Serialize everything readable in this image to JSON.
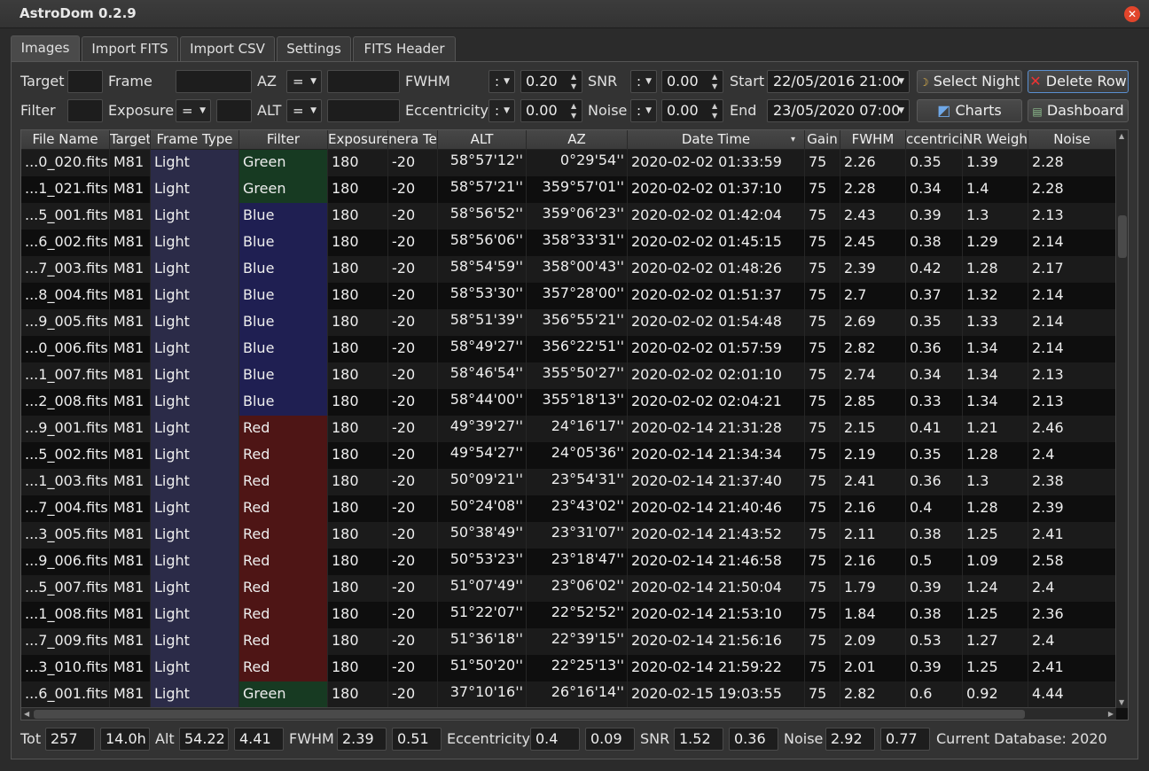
{
  "window": {
    "title": "AstroDom 0.2.9",
    "close_icon": "close-icon"
  },
  "tabs": [
    "Images",
    "Import FITS",
    "Import CSV",
    "Settings",
    "FITS Header"
  ],
  "filters": {
    "target_label": "Target",
    "target_value": "",
    "frame_label": "Frame",
    "frame_value": "",
    "az_label": "AZ",
    "az_op": "=",
    "az_value": "",
    "fwhm_label": "FWHM",
    "fwhm_op": ":",
    "fwhm_value": "0.20",
    "snr_label": "SNR",
    "snr_op": ":",
    "snr_value": "0.00",
    "start_label": "Start",
    "start_value": "22/05/2016 21:00",
    "filter_label": "Filter",
    "filter_value": "",
    "exposure_label": "Exposure",
    "exposure_op": "=",
    "exposure_value": "",
    "alt_label": "ALT",
    "alt_op": "=",
    "alt_value": "",
    "ecc_label": "Eccentricity",
    "ecc_op": ":",
    "ecc_value": "0.00",
    "noise_label": "Noise",
    "noise_op": ":",
    "noise_value": "0.00",
    "end_label": "End",
    "end_value": "23/05/2020 07:00"
  },
  "buttons": {
    "select_night": "Select Night",
    "delete_row": "Delete Row",
    "charts": "Charts",
    "dashboard": "Dashboard"
  },
  "table": {
    "columns": [
      "File Name",
      "Target",
      "Frame Type",
      "Filter",
      "Exposure",
      "nera Te",
      "ALT",
      "AZ",
      "Date Time",
      "Gain",
      "FWHM",
      "ccentrici",
      "NR Weigh",
      "Noise"
    ],
    "sort_indicator": "▾",
    "rows": [
      [
        "...0_020.fits",
        "M81",
        "Light",
        "Green",
        "180",
        "-20",
        "58°57'12''",
        "0°29'54''",
        "2020-02-02  01:33:59",
        "75",
        "2.26",
        "0.35",
        "1.39",
        "2.28"
      ],
      [
        "...1_021.fits",
        "M81",
        "Light",
        "Green",
        "180",
        "-20",
        "58°57'21''",
        "359°57'01''",
        "2020-02-02  01:37:10",
        "75",
        "2.28",
        "0.34",
        "1.4",
        "2.28"
      ],
      [
        "...5_001.fits",
        "M81",
        "Light",
        "Blue",
        "180",
        "-20",
        "58°56'52''",
        "359°06'23''",
        "2020-02-02  01:42:04",
        "75",
        "2.43",
        "0.39",
        "1.3",
        "2.13"
      ],
      [
        "...6_002.fits",
        "M81",
        "Light",
        "Blue",
        "180",
        "-20",
        "58°56'06''",
        "358°33'31''",
        "2020-02-02  01:45:15",
        "75",
        "2.45",
        "0.38",
        "1.29",
        "2.14"
      ],
      [
        "...7_003.fits",
        "M81",
        "Light",
        "Blue",
        "180",
        "-20",
        "58°54'59''",
        "358°00'43''",
        "2020-02-02  01:48:26",
        "75",
        "2.39",
        "0.42",
        "1.28",
        "2.17"
      ],
      [
        "...8_004.fits",
        "M81",
        "Light",
        "Blue",
        "180",
        "-20",
        "58°53'30''",
        "357°28'00''",
        "2020-02-02  01:51:37",
        "75",
        "2.7",
        "0.37",
        "1.32",
        "2.14"
      ],
      [
        "...9_005.fits",
        "M81",
        "Light",
        "Blue",
        "180",
        "-20",
        "58°51'39''",
        "356°55'21''",
        "2020-02-02  01:54:48",
        "75",
        "2.69",
        "0.35",
        "1.33",
        "2.14"
      ],
      [
        "...0_006.fits",
        "M81",
        "Light",
        "Blue",
        "180",
        "-20",
        "58°49'27''",
        "356°22'51''",
        "2020-02-02  01:57:59",
        "75",
        "2.82",
        "0.36",
        "1.34",
        "2.14"
      ],
      [
        "...1_007.fits",
        "M81",
        "Light",
        "Blue",
        "180",
        "-20",
        "58°46'54''",
        "355°50'27''",
        "2020-02-02  02:01:10",
        "75",
        "2.74",
        "0.34",
        "1.34",
        "2.13"
      ],
      [
        "...2_008.fits",
        "M81",
        "Light",
        "Blue",
        "180",
        "-20",
        "58°44'00''",
        "355°18'13''",
        "2020-02-02  02:04:21",
        "75",
        "2.85",
        "0.33",
        "1.34",
        "2.13"
      ],
      [
        "...9_001.fits",
        "M81",
        "Light",
        "Red",
        "180",
        "-20",
        "49°39'27''",
        "24°16'17''",
        "2020-02-14  21:31:28",
        "75",
        "2.15",
        "0.41",
        "1.21",
        "2.46"
      ],
      [
        "...5_002.fits",
        "M81",
        "Light",
        "Red",
        "180",
        "-20",
        "49°54'27''",
        "24°05'36''",
        "2020-02-14  21:34:34",
        "75",
        "2.19",
        "0.35",
        "1.28",
        "2.4"
      ],
      [
        "...1_003.fits",
        "M81",
        "Light",
        "Red",
        "180",
        "-20",
        "50°09'21''",
        "23°54'31''",
        "2020-02-14  21:37:40",
        "75",
        "2.41",
        "0.36",
        "1.3",
        "2.38"
      ],
      [
        "...7_004.fits",
        "M81",
        "Light",
        "Red",
        "180",
        "-20",
        "50°24'08''",
        "23°43'02''",
        "2020-02-14  21:40:46",
        "75",
        "2.16",
        "0.4",
        "1.28",
        "2.39"
      ],
      [
        "...3_005.fits",
        "M81",
        "Light",
        "Red",
        "180",
        "-20",
        "50°38'49''",
        "23°31'07''",
        "2020-02-14  21:43:52",
        "75",
        "2.11",
        "0.38",
        "1.25",
        "2.41"
      ],
      [
        "...9_006.fits",
        "M81",
        "Light",
        "Red",
        "180",
        "-20",
        "50°53'23''",
        "23°18'47''",
        "2020-02-14  21:46:58",
        "75",
        "2.16",
        "0.5",
        "1.09",
        "2.58"
      ],
      [
        "...5_007.fits",
        "M81",
        "Light",
        "Red",
        "180",
        "-20",
        "51°07'49''",
        "23°06'02''",
        "2020-02-14  21:50:04",
        "75",
        "1.79",
        "0.39",
        "1.24",
        "2.4"
      ],
      [
        "...1_008.fits",
        "M81",
        "Light",
        "Red",
        "180",
        "-20",
        "51°22'07''",
        "22°52'52''",
        "2020-02-14  21:53:10",
        "75",
        "1.84",
        "0.38",
        "1.25",
        "2.36"
      ],
      [
        "...7_009.fits",
        "M81",
        "Light",
        "Red",
        "180",
        "-20",
        "51°36'18''",
        "22°39'15''",
        "2020-02-14  21:56:16",
        "75",
        "2.09",
        "0.53",
        "1.27",
        "2.4"
      ],
      [
        "...3_010.fits",
        "M81",
        "Light",
        "Red",
        "180",
        "-20",
        "51°50'20''",
        "22°25'13''",
        "2020-02-14  21:59:22",
        "75",
        "2.01",
        "0.39",
        "1.25",
        "2.41"
      ],
      [
        "...6_001.fits",
        "M81",
        "Light",
        "Green",
        "180",
        "-20",
        "37°10'16''",
        "26°16'14''",
        "2020-02-15  19:03:55",
        "75",
        "2.82",
        "0.6",
        "0.92",
        "4.44"
      ]
    ]
  },
  "footer": {
    "tot_label": "Tot",
    "tot_count": "257",
    "tot_hours": "14.0h",
    "alt_label": "Alt",
    "alt_mean": "54.22",
    "alt_sd": "4.41",
    "fwhm_label": "FWHM",
    "fwhm_mean": "2.39",
    "fwhm_sd": "0.51",
    "ecc_label": "Eccentricity",
    "ecc_mean": "0.4",
    "ecc_sd": "0.09",
    "snr_label": "SNR",
    "snr_mean": "1.52",
    "snr_sd": "0.36",
    "noise_label": "Noise",
    "noise_mean": "2.92",
    "noise_sd": "0.77",
    "db_label": "Current Database: 2020"
  }
}
